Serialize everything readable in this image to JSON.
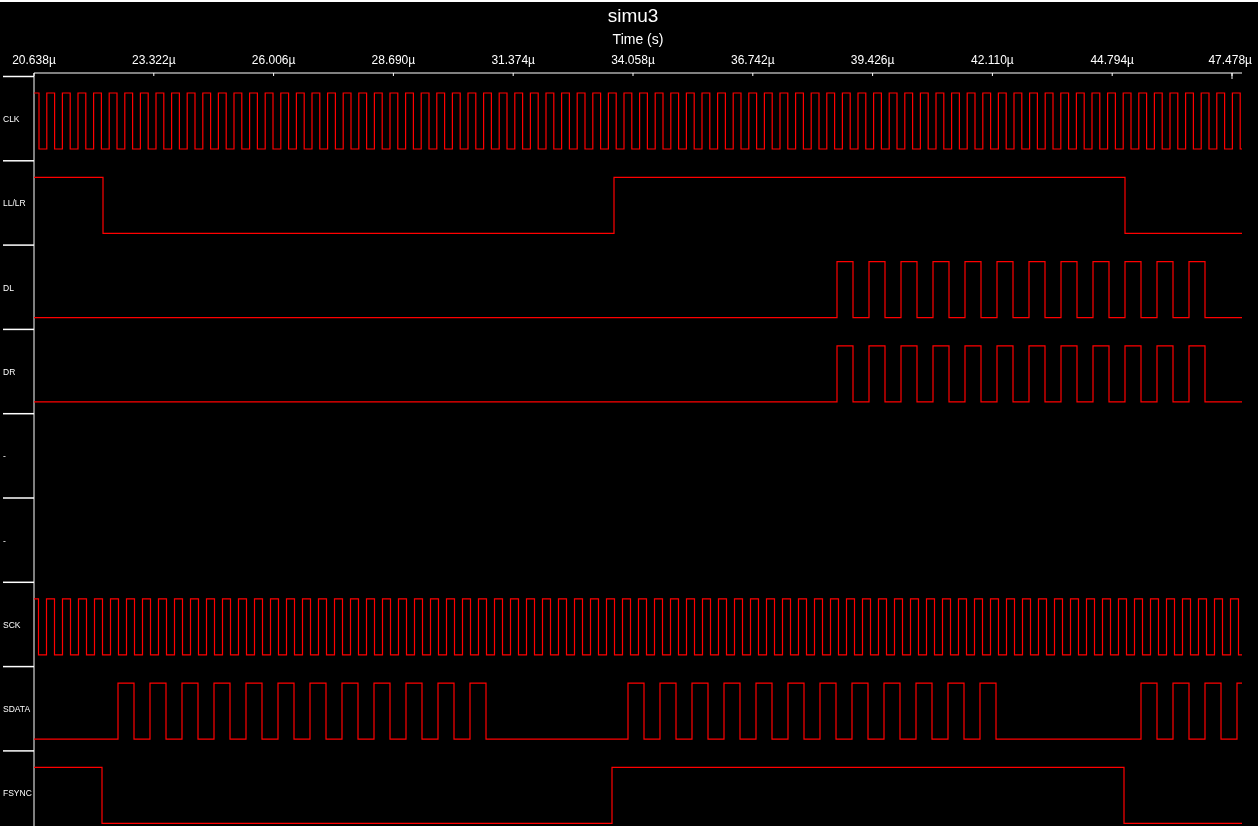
{
  "window": {
    "title": "simu3"
  },
  "time_axis": {
    "label": "Time (s)",
    "ticks": [
      "20.638µ",
      "23.322µ",
      "26.006µ",
      "28.690µ",
      "31.374µ",
      "34.058µ",
      "36.742µ",
      "39.426µ",
      "42.110µ",
      "44.794µ",
      "47.478µ"
    ]
  },
  "signals": [
    {
      "name": "CLK"
    },
    {
      "name": "LL/LR"
    },
    {
      "name": "DL"
    },
    {
      "name": "DR"
    },
    {
      "name": "-"
    },
    {
      "name": "-"
    },
    {
      "name": "SCK"
    },
    {
      "name": "SDATA"
    },
    {
      "name": "FSYNC"
    }
  ]
}
